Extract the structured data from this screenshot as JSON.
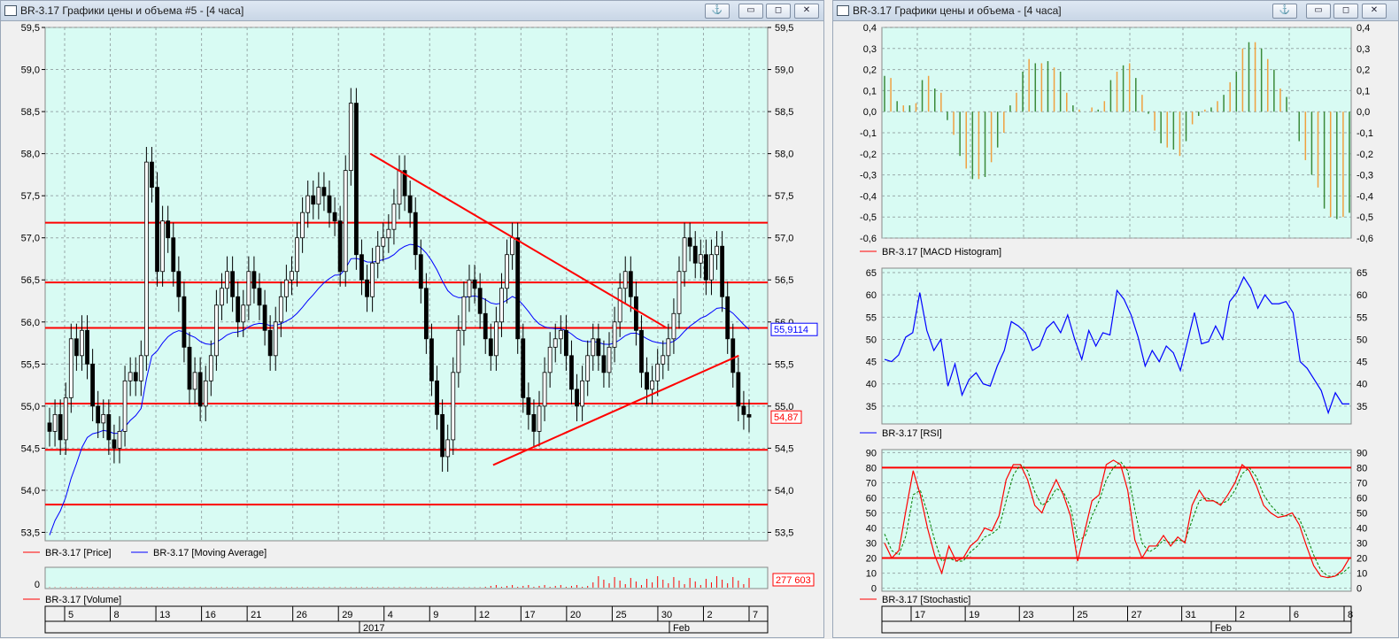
{
  "window_left": {
    "title": "BR-3.17 Графики цены и объема #5 - [4 часа]",
    "buttons": {
      "anchor": "⚓",
      "minimize": "▭",
      "restore": "◻",
      "close": "✕"
    },
    "price_legend": [
      "BR-3.17 [Price]",
      "BR-3.17 [Moving Average]"
    ],
    "volume_legend": "BR-3.17 [Volume]",
    "volume_zero_label": "0",
    "volume_value_label": "277 603",
    "price_last_label": "54,87",
    "ma_last_label": "55,9114",
    "x_day_labels": [
      "5",
      "8",
      "13",
      "16",
      "21",
      "26",
      "29",
      "4",
      "9",
      "12",
      "17",
      "20",
      "25",
      "30",
      "2",
      "7"
    ],
    "x_month_labels": [
      "2017",
      "Feb"
    ]
  },
  "window_right": {
    "title": "BR-3.17 Графики цены и объема - [4 часа]",
    "buttons": {
      "anchor": "⚓",
      "minimize": "▭",
      "restore": "◻",
      "close": "✕"
    },
    "macd_legend": "BR-3.17 [MACD Histogram]",
    "rsi_legend": "BR-3.17 [RSI]",
    "stoch_legend": "BR-3.17 [Stochastic]",
    "x_day_labels": [
      "17",
      "19",
      "23",
      "25",
      "27",
      "31",
      "2",
      "6",
      "8"
    ],
    "x_month_labels": [
      "Feb"
    ]
  },
  "colors": {
    "plot_bg": "#d8fbf3",
    "price_line": "#ff0000",
    "ma_line": "#0000ff",
    "macd_pos": "#3a8a3a",
    "macd_neg": "#f0a040",
    "rsi_line": "#0000ff",
    "stoch_k": "#ff0000",
    "stoch_d": "#008000"
  },
  "chart_data": [
    {
      "type": "candlestick",
      "series_names": [
        "BR-3.17 [Price]",
        "BR-3.17 [Moving Average]"
      ],
      "ylim": [
        53.4,
        59.5
      ],
      "y_ticks": [
        53.5,
        54.0,
        54.5,
        55.0,
        55.5,
        56.0,
        56.5,
        57.0,
        57.5,
        58.0,
        58.5,
        59.0,
        59.5
      ],
      "y_tick_labels": [
        "53,5",
        "54,0",
        "54,5",
        "55,0",
        "55,5",
        "56,0",
        "56,5",
        "57,0",
        "57,5",
        "58,0",
        "58,5",
        "59,0",
        "59,5"
      ],
      "closes": [
        54.7,
        54.9,
        54.6,
        55.1,
        55.8,
        55.6,
        55.9,
        55.5,
        55.0,
        54.8,
        54.9,
        54.6,
        54.5,
        54.7,
        55.3,
        55.4,
        55.3,
        55.6,
        57.9,
        57.6,
        56.6,
        57.2,
        57.0,
        56.6,
        56.3,
        55.7,
        55.2,
        55.4,
        55.0,
        55.3,
        55.6,
        56.2,
        56.4,
        56.6,
        56.3,
        56.0,
        56.2,
        56.6,
        56.4,
        56.2,
        55.9,
        55.6,
        56.0,
        56.3,
        56.5,
        56.6,
        57.0,
        57.3,
        57.5,
        57.4,
        57.6,
        57.5,
        57.3,
        57.2,
        56.6,
        57.8,
        58.6,
        56.8,
        56.5,
        56.3,
        56.7,
        56.9,
        57.0,
        57.1,
        57.4,
        57.8,
        57.5,
        57.3,
        56.8,
        56.4,
        55.8,
        55.3,
        54.9,
        54.4,
        54.6,
        55.4,
        55.9,
        56.3,
        56.5,
        56.4,
        56.1,
        55.8,
        55.6,
        56.0,
        56.4,
        56.8,
        57.0,
        55.8,
        55.1,
        54.9,
        54.7,
        55.0,
        55.4,
        55.7,
        55.8,
        55.9,
        55.6,
        55.2,
        55.0,
        55.3,
        55.6,
        55.8,
        55.6,
        55.4,
        55.7,
        56.0,
        56.4,
        56.6,
        56.3,
        55.9,
        55.4,
        55.2,
        55.3,
        55.5,
        55.6,
        55.8,
        56.1,
        56.6,
        57.0,
        56.9,
        56.7,
        56.8,
        56.5,
        56.8,
        56.9,
        56.3,
        55.8,
        55.4,
        55.0,
        54.9,
        54.87
      ],
      "ma_start": 53.3,
      "ma_end": 55.9114,
      "support_levels": [
        57.18,
        56.47,
        55.93,
        55.03,
        54.48,
        53.83
      ],
      "trendlines": [
        [
          [
            0.45,
            58.0
          ],
          [
            0.86,
            55.93
          ]
        ],
        [
          [
            0.62,
            54.3
          ],
          [
            0.96,
            55.6
          ]
        ]
      ],
      "last_price": 54.87,
      "last_ma": 55.9114
    },
    {
      "type": "bar",
      "series_names": [
        "BR-3.17 [Volume]"
      ],
      "last_value": 277603
    },
    {
      "type": "bar",
      "series_names": [
        "BR-3.17 [MACD Histogram]"
      ],
      "ylim": [
        -0.6,
        0.4
      ],
      "y_ticks": [
        -0.6,
        -0.5,
        -0.4,
        -0.3,
        -0.2,
        -0.1,
        0.0,
        0.1,
        0.2,
        0.3,
        0.4
      ],
      "y_tick_labels": [
        "-0,6",
        "-0,5",
        "-0,4",
        "-0,3",
        "-0,2",
        "-0,1",
        "0,0",
        "0,1",
        "0,2",
        "0,3",
        "0,4"
      ],
      "values": [
        0.17,
        0.16,
        0.05,
        0.03,
        0.03,
        0.04,
        0.15,
        0.17,
        0.11,
        0.09,
        -0.04,
        -0.11,
        -0.21,
        -0.27,
        -0.32,
        -0.32,
        -0.31,
        -0.24,
        -0.17,
        -0.1,
        0.03,
        0.09,
        0.19,
        0.25,
        0.23,
        0.23,
        0.24,
        0.21,
        0.19,
        0.09,
        0.03,
        0.01,
        0.0,
        0.02,
        0.01,
        0.05,
        0.15,
        0.19,
        0.22,
        0.23,
        0.16,
        0.08,
        -0.01,
        -0.09,
        -0.15,
        -0.17,
        -0.18,
        -0.21,
        -0.14,
        -0.06,
        -0.02,
        0.01,
        0.02,
        0.05,
        0.08,
        0.14,
        0.19,
        0.3,
        0.33,
        0.33,
        0.3,
        0.25,
        0.2,
        0.11,
        0.07,
        0.0,
        -0.14,
        -0.23,
        -0.3,
        -0.36,
        -0.46,
        -0.5,
        -0.51,
        -0.5,
        -0.48
      ]
    },
    {
      "type": "line",
      "series_names": [
        "BR-3.17 [RSI]"
      ],
      "ylim": [
        31,
        66
      ],
      "y_ticks": [
        35,
        40,
        45,
        50,
        55,
        60,
        65
      ],
      "values": [
        45.5,
        45.0,
        46.5,
        50.5,
        51.5,
        60.5,
        52.0,
        47.5,
        50.0,
        39.5,
        44.5,
        37.5,
        41.0,
        42.5,
        40.0,
        39.5,
        44.0,
        47.5,
        54.0,
        53.0,
        51.5,
        47.5,
        48.5,
        52.5,
        54.0,
        51.5,
        55.5,
        50.0,
        45.5,
        52.0,
        48.5,
        51.5,
        51.0,
        61.0,
        59.0,
        55.5,
        50.5,
        44.0,
        47.5,
        45.0,
        48.5,
        47.0,
        43.0,
        49.5,
        56.0,
        49.0,
        49.5,
        53.0,
        50.0,
        58.5,
        60.5,
        64.0,
        61.5,
        57.0,
        60.0,
        58.0,
        58.0,
        58.5,
        56.0,
        45.0,
        43.5,
        41.0,
        38.5,
        33.5,
        38.0,
        35.5,
        35.5
      ]
    },
    {
      "type": "line",
      "series_names": [
        "BR-3.17 [Stochastic]"
      ],
      "ylim": [
        -2,
        92
      ],
      "y_ticks": [
        0,
        10,
        20,
        30,
        40,
        50,
        60,
        70,
        80,
        90
      ],
      "levels": [
        80,
        20
      ],
      "k_values": [
        30,
        20,
        25,
        52,
        78,
        62,
        40,
        22,
        10,
        28,
        18,
        20,
        28,
        32,
        40,
        38,
        48,
        72,
        82,
        82,
        72,
        55,
        50,
        62,
        72,
        62,
        48,
        18,
        38,
        58,
        62,
        82,
        85,
        82,
        65,
        32,
        20,
        28,
        28,
        35,
        28,
        34,
        30,
        55,
        65,
        58,
        58,
        55,
        62,
        70,
        82,
        78,
        68,
        55,
        50,
        47,
        48,
        50,
        42,
        28,
        15,
        8,
        7,
        8,
        12,
        20
      ],
      "d_values": [
        36,
        25,
        22,
        35,
        62,
        65,
        50,
        32,
        18,
        20,
        18,
        18,
        24,
        28,
        34,
        36,
        40,
        58,
        75,
        82,
        78,
        64,
        55,
        58,
        66,
        64,
        54,
        32,
        34,
        48,
        58,
        72,
        80,
        84,
        78,
        52,
        30,
        24,
        27,
        32,
        30,
        32,
        31,
        45,
        58,
        60,
        58,
        56,
        58,
        65,
        76,
        80,
        74,
        62,
        55,
        50,
        48,
        48,
        46,
        35,
        22,
        12,
        8,
        8,
        10,
        14
      ]
    }
  ]
}
